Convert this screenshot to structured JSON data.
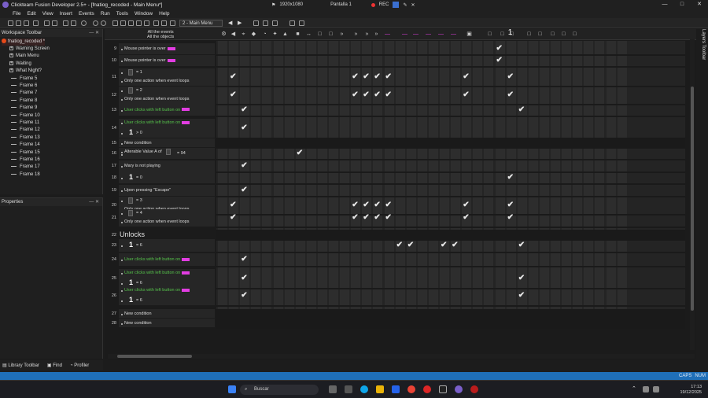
{
  "window": {
    "title": "Clickteam Fusion Developer 2.5+ - [fnatiog_recoded - Main Menu*]"
  },
  "recording": {
    "resolution": "1920x1080",
    "screen": "Pantalla 1",
    "rec_label": "REC"
  },
  "menu": [
    "File",
    "Edit",
    "View",
    "Insert",
    "Events",
    "Run",
    "Tools",
    "Window",
    "Help"
  ],
  "toolbar": {
    "frame_selector": "2 - Main Menu"
  },
  "workspace": {
    "title": "Workspace Toolbar",
    "pins": "— ✕",
    "project": "fnatiog_recoded *",
    "frames": [
      "Warning Screen",
      "Main Menu",
      "Waiting",
      "What Night?",
      "Frame 5",
      "Frame 6",
      "Frame 7",
      "Frame 8",
      "Frame 9",
      "Frame 10",
      "Frame 11",
      "Frame 12",
      "Frame 13",
      "Frame 14",
      "Frame 15",
      "Frame 16",
      "Frame 17",
      "Frame 18"
    ]
  },
  "properties": {
    "title": "Properties",
    "pins": "— ✕"
  },
  "bottom_tabs": [
    "Library Toolbar",
    "Find",
    "Profiler"
  ],
  "editor": {
    "all_events": "All the events",
    "all_objects": "All the objects",
    "header_num": "1"
  },
  "events": [
    {
      "n": "9",
      "lines": [
        "Mouse pointer is over"
      ]
    },
    {
      "n": "10",
      "lines": [
        "Mouse pointer is over"
      ]
    },
    {
      "n": "11",
      "lines": [
        "= 1",
        "Only one action when event loops"
      ]
    },
    {
      "n": "12",
      "lines": [
        "= 2",
        "Only one action when event loops"
      ]
    },
    {
      "n": "13",
      "lines": [
        "User clicks with left button on"
      ]
    },
    {
      "n": "14",
      "lines": [
        "User clicks with left button on",
        "> 0"
      ]
    },
    {
      "n": "15",
      "lines": [
        "New condition"
      ]
    },
    {
      "n": "16",
      "lines": [
        "Alterable Value A of",
        "= 94"
      ]
    },
    {
      "n": "17",
      "lines": [
        "Mary is not playing"
      ]
    },
    {
      "n": "18",
      "lines": [
        "= 0"
      ]
    },
    {
      "n": "19",
      "lines": [
        "Upon pressing \"Escape\""
      ]
    },
    {
      "n": "20",
      "lines": [
        "= 3",
        "Only one action when event loops"
      ]
    },
    {
      "n": "21",
      "lines": [
        "= 4",
        "Only one action when event loops"
      ]
    },
    {
      "n": "22",
      "lines": [
        "Unlocks"
      ]
    },
    {
      "n": "23",
      "lines": [
        "= 6"
      ]
    },
    {
      "n": "24",
      "lines": [
        "User clicks with left button on"
      ]
    },
    {
      "n": "25",
      "lines": [
        "User clicks with left button on",
        "= 6"
      ]
    },
    {
      "n": "26",
      "lines": [
        "User clicks with left button on",
        "= 6"
      ]
    },
    {
      "n": "27",
      "lines": [
        "New condition"
      ]
    },
    {
      "n": "28",
      "lines": [
        "New condition"
      ]
    }
  ],
  "layers_tab": "Layers Toolbar",
  "statusbar": {
    "caps": "CAPS",
    "num": "NUM"
  },
  "taskbar": {
    "search": "Buscar",
    "time": "17:13",
    "date": "19/12/2025"
  },
  "colors": {
    "accent": "#1f6fb8",
    "condition_green": "#55c24a",
    "magenta": "#e23de2"
  }
}
